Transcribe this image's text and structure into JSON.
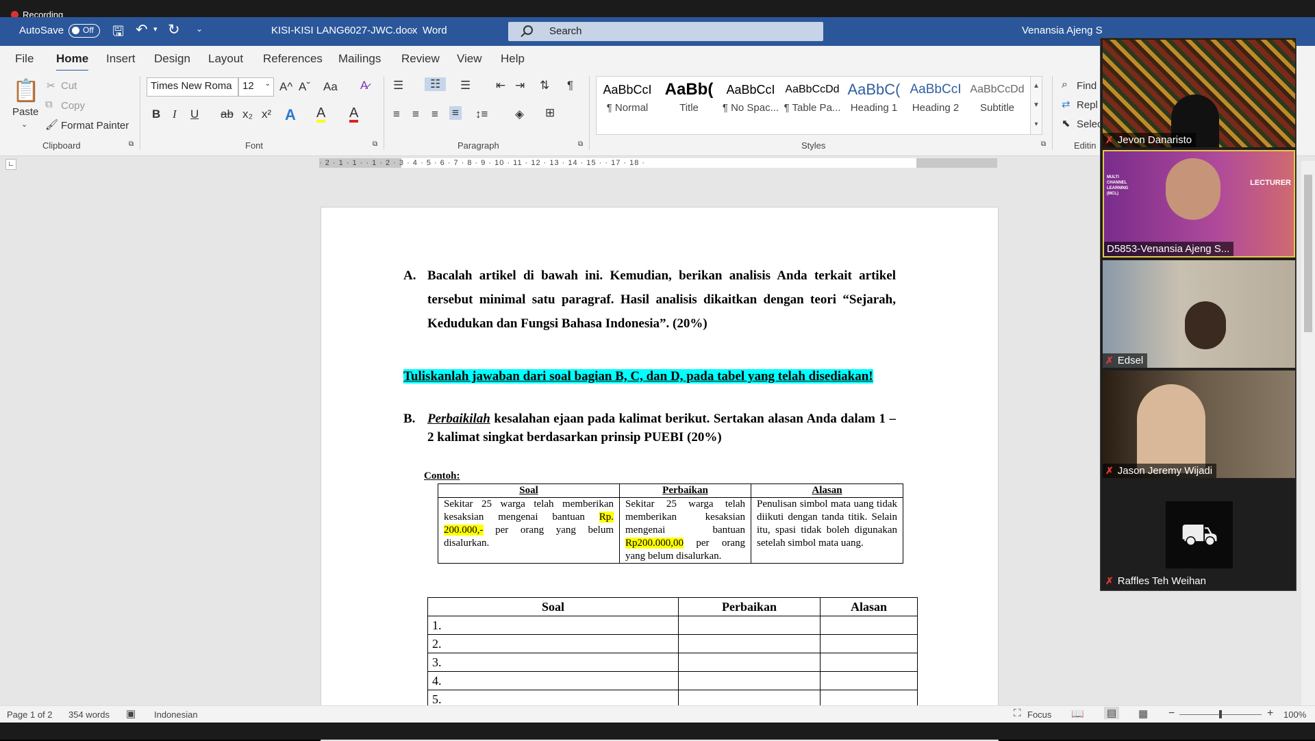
{
  "recording": "Recording",
  "titlebar": {
    "autosave": "AutoSave",
    "toggle": "Off",
    "doc_title": "KISI-KISI LANG6027-JWC.docx",
    "separator": "-",
    "app": "Word",
    "search_placeholder": "Search",
    "user": "Venansia Ajeng S"
  },
  "menu": [
    "File",
    "Home",
    "Insert",
    "Design",
    "Layout",
    "References",
    "Mailings",
    "Review",
    "View",
    "Help"
  ],
  "clipboard": {
    "paste": "Paste",
    "cut": "Cut",
    "copy": "Copy",
    "format_painter": "Format Painter",
    "group": "Clipboard"
  },
  "font": {
    "name": "Times New Roma",
    "size": "12",
    "group": "Font",
    "bold": "B",
    "italic": "I",
    "underline": "U",
    "strike": "ab",
    "sub": "x₂",
    "sup": "x²",
    "case": "Aa",
    "grow": "A^",
    "shrink": "Aˇ",
    "effects": "A",
    "highlight": "A",
    "color": "A"
  },
  "paragraph": {
    "group": "Paragraph"
  },
  "styles": {
    "group": "Styles",
    "items": [
      {
        "preview": "AaBbCcI",
        "name": "¶ Normal"
      },
      {
        "preview": "AaBb(",
        "name": "Title"
      },
      {
        "preview": "AaBbCcI",
        "name": "¶ No Spac..."
      },
      {
        "preview": "AaBbCcDd",
        "name": "¶ Table Pa..."
      },
      {
        "preview": "AaBbC(",
        "name": "Heading 1"
      },
      {
        "preview": "AaBbCcI",
        "name": "Heading 2"
      },
      {
        "preview": "AaBbCcDd",
        "name": "Subtitle"
      }
    ]
  },
  "editing": {
    "find": "Find",
    "replace": "Repl",
    "select": "Selec",
    "group": "Editin"
  },
  "ruler": "· 2 · 1 · 1 ·   · 1 · 2 · 3 · 4 · 5 · 6 · 7 · 8 · 9 · 10 · 11 · 12 · 13 · 14 · 15 ·   · 17 · 18 ·",
  "doc": {
    "a_label": "A.",
    "a_text": "Bacalah artikel di bawah ini. Kemudian, berikan analisis Anda terkait artikel tersebut minimal satu paragraf. Hasil analisis dikaitkan dengan teori “Sejarah, Kedudukan dan Fungsi Bahasa Indonesia”. (20%)",
    "instruction": "Tuliskanlah jawaban dari soal bagian B, C, dan D, pada tabel yang telah disediakan!",
    "b_label": "B.",
    "b_italic": "Perbaikilah",
    "b_text": " kesalahan ejaan pada kalimat berikut. Sertakan alasan Anda dalam 1 – 2 kalimat singkat berdasarkan prinsip PUEBI (20%)",
    "contoh": "Contoh:",
    "example": {
      "headers": [
        "Soal",
        "Perbaikan",
        "Alasan"
      ],
      "soal_a": "Sekitar 25 warga telah memberikan kesaksian mengenai bantuan ",
      "soal_hl": "Rp. 200.000,-",
      "soal_b": " per orang yang belum disalurkan.",
      "perb_a": "Sekitar 25 warga telah memberikan kesaksian mengenai bantuan ",
      "perb_hl": "Rp200.000,00",
      "perb_b": " per orang yang belum disalurkan.",
      "alasan": "Penulisan simbol mata uang tidak diikuti dengan tanda titik. Selain itu, spasi tidak boleh digunakan setelah simbol mata uang."
    },
    "answer": {
      "headers": [
        "Soal",
        "Perbaikan",
        "Alasan"
      ],
      "rows": [
        "1.",
        "2.",
        "3.",
        "4.",
        "5."
      ]
    }
  },
  "status": {
    "page": "Page 1 of 2",
    "words": "354 words",
    "lang": "Indonesian",
    "focus": "Focus",
    "zoom": "100%"
  },
  "participants": [
    {
      "name": "Jevon Danaristo"
    },
    {
      "name": "D5853-Venansia Ajeng S..."
    },
    {
      "name": "Edsel"
    },
    {
      "name": "Jason Jeremy Wijadi"
    },
    {
      "name": "Raffles Teh Weihan"
    }
  ],
  "tile_text": {
    "mcl": "MULTI CHANNEL LEARNING (MCL)",
    "lecturer": "LECTURER"
  },
  "colors": {
    "word_blue": "#2b579a",
    "ribbon": "#f3f3f3",
    "highlight_cyan": "#00ffff",
    "highlight_yellow": "#ffff00"
  }
}
